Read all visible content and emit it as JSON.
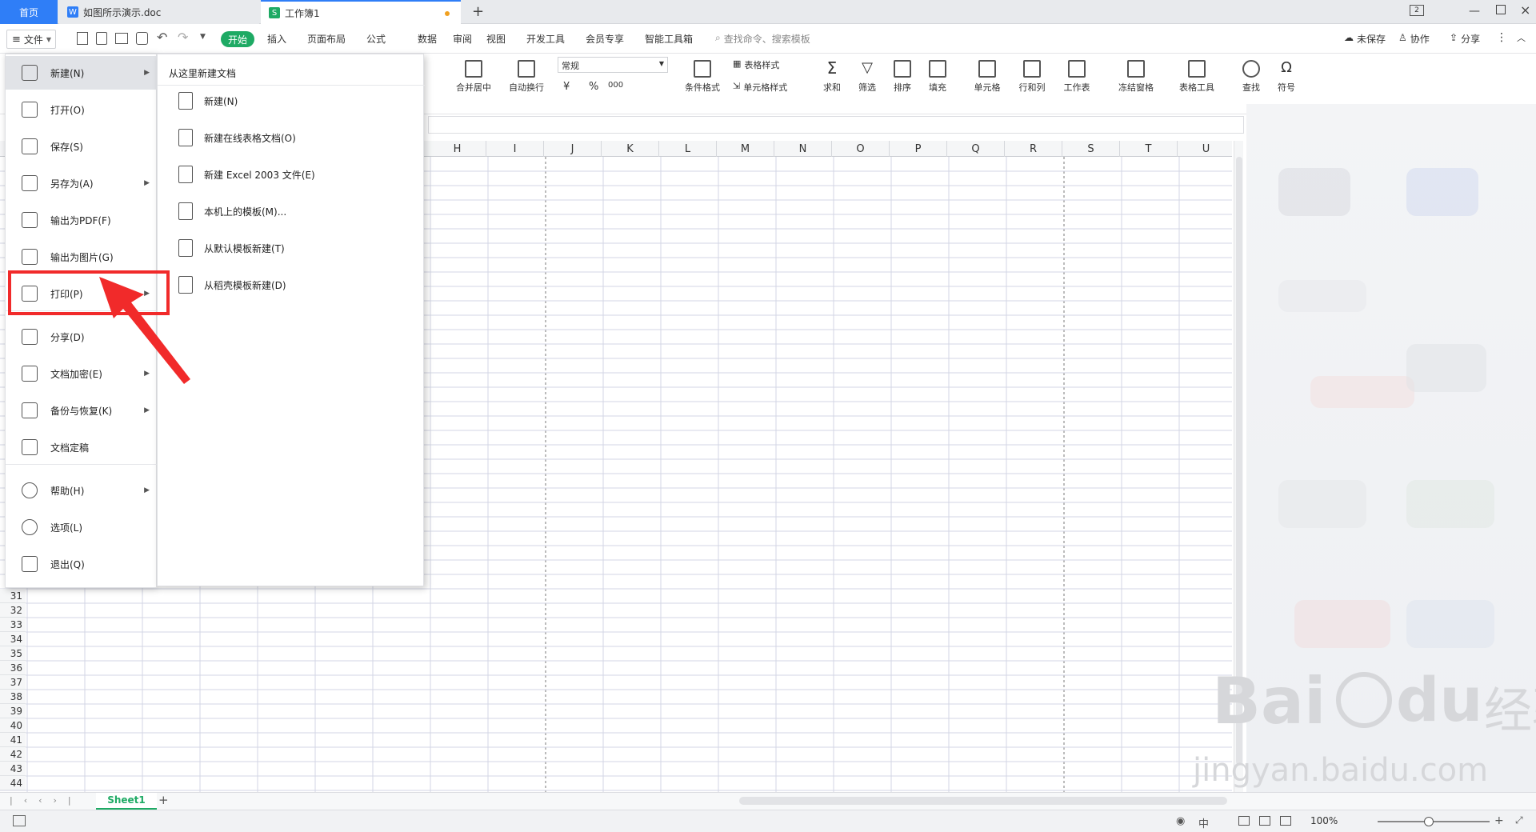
{
  "tabs": {
    "home": "首页",
    "doc": "如图所示演示.doc",
    "xls": "工作簿1",
    "doc_icon": "W",
    "xls_icon": "S",
    "add": "+",
    "badge": "2"
  },
  "menubar": {
    "file": "文件",
    "start": "开始",
    "items": [
      "插入",
      "页面布局",
      "公式",
      "数据",
      "审阅",
      "视图",
      "开发工具",
      "会员专享",
      "智能工具箱"
    ],
    "search_placeholder": "查找命令、搜索模板",
    "unsaved": "未保存",
    "collab": "协作",
    "share": "分享"
  },
  "ribbon": {
    "merge": "合并居中",
    "wrap": "自动换行",
    "format_value": "常规",
    "currency": "¥",
    "percent": "%",
    "thousands": "000",
    "table_style": "表格样式",
    "cond_format": "条件格式",
    "cell_style": "单元格样式",
    "sum": "求和",
    "filter": "筛选",
    "sort": "排序",
    "fill": "填充",
    "cell": "单元格",
    "rowcol": "行和列",
    "sheet": "工作表",
    "freeze": "冻结窗格",
    "table_tools": "表格工具",
    "find": "查找",
    "symbol": "符号"
  },
  "columns": [
    "H",
    "I",
    "J",
    "K",
    "L",
    "M",
    "N",
    "O",
    "P",
    "Q",
    "R",
    "S",
    "T",
    "U"
  ],
  "rows": [
    "31",
    "32",
    "33",
    "34",
    "35",
    "36",
    "37",
    "38",
    "39",
    "40",
    "41",
    "42",
    "43",
    "44"
  ],
  "file_menu": {
    "items": [
      {
        "label": "新建(N)",
        "arrow": true
      },
      {
        "label": "打开(O)",
        "arrow": false
      },
      {
        "label": "保存(S)",
        "arrow": false
      },
      {
        "label": "另存为(A)",
        "arrow": true
      },
      {
        "label": "输出为PDF(F)",
        "arrow": false
      },
      {
        "label": "输出为图片(G)",
        "arrow": false
      },
      {
        "label": "打印(P)",
        "arrow": true
      },
      {
        "label": "分享(D)",
        "arrow": false
      },
      {
        "label": "文档加密(E)",
        "arrow": true
      },
      {
        "label": "备份与恢复(K)",
        "arrow": true
      },
      {
        "label": "文档定稿",
        "arrow": false
      },
      {
        "label": "帮助(H)",
        "arrow": true
      },
      {
        "label": "选项(L)",
        "arrow": false
      },
      {
        "label": "退出(Q)",
        "arrow": false
      }
    ]
  },
  "submenu": {
    "title": "从这里新建文档",
    "items": [
      "新建(N)",
      "新建在线表格文档(O)",
      "新建 Excel 2003 文件(E)",
      "本机上的模板(M)...",
      "从默认模板新建(T)",
      "从稻壳模板新建(D)"
    ]
  },
  "sheet": {
    "name": "Sheet1",
    "add": "+"
  },
  "status": {
    "zoom": "100%"
  },
  "watermark": {
    "brand": "Bai",
    "du": "du",
    "cn": "经验",
    "url": "jingyan.baidu.com"
  },
  "colors": {
    "accent_green": "#1eaa64",
    "accent_blue": "#2f7ef7",
    "highlight_red": "#f12a2a"
  }
}
